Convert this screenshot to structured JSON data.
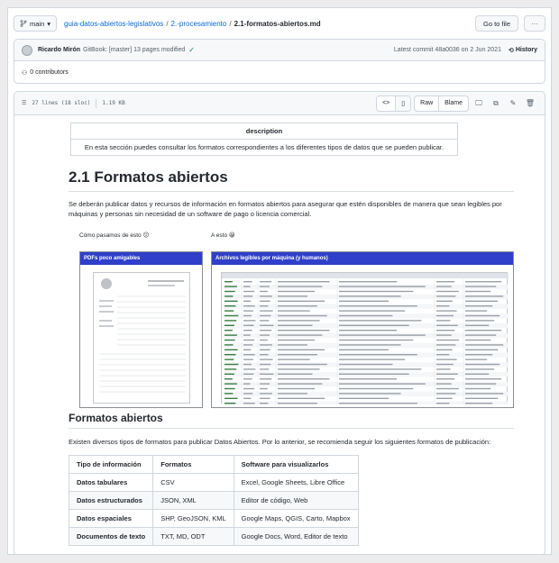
{
  "topbar": {
    "branch": "main",
    "crumbs": [
      {
        "text": "guia-datos-abiertos-legislativos",
        "link": true
      },
      {
        "text": "2.-procesamiento",
        "link": true
      },
      {
        "text": "2.1-formatos-abiertos.md",
        "link": false
      }
    ],
    "go_to_file": "Go to file",
    "more": "···"
  },
  "commit": {
    "author": "Ricardo Mirón",
    "message": "GitBook: [master] 13 pages modified",
    "latest": "Latest commit 48a0036 on 2 Jun 2021",
    "history": "History",
    "contributors": "0 contributors"
  },
  "file": {
    "lines": "27 lines (18 sloc)",
    "size": "1.19 KB",
    "raw": "Raw",
    "blame": "Blame"
  },
  "doc": {
    "desc_header": "description",
    "desc_text": "En esta sección puedes consultar los formatos correspondientes a los diferentes tipos de datos que se pueden publicar.",
    "h1": "2.1 Formatos abiertos",
    "intro": "Se deberán publicar datos y recursos de información en formatos abiertos para asegurar que estén disponibles de manera que sean legibles por máquinas y personas sin necesidad de un software de pago o licencia comercial.",
    "fig_left_caption": "Cómo pasamos de esto 😕",
    "fig_right_caption": "A esto 😀",
    "fig_left_title": "PDFs poco amigables",
    "fig_right_title": "Archivos legibles por máquina (y humanos)",
    "h2": "Formatos abiertos",
    "formats_intro": "Existen diversos tipos de formatos para publicar Datos Abiertos. Por lo anterior, se recomienda seguir los siguientes formatos de publicación:",
    "table": {
      "headers": [
        "Tipo de información",
        "Formatos",
        "Software para visualizarlos"
      ],
      "rows": [
        [
          "Datos tabulares",
          "CSV",
          "Excel, Google Sheets, Libre Office"
        ],
        [
          "Datos estructurados",
          "JSON, XML",
          "Editor de código, Web"
        ],
        [
          "Datos espaciales",
          "SHP, GeoJSON, KML",
          "Google Maps, QGIS, Carto, Mapbox"
        ],
        [
          "Documentos de texto",
          "TXT, MD, ODT",
          "Google Docs, Word, Editor de texto"
        ]
      ]
    }
  },
  "colors": {
    "link": "#0969da",
    "band": "#2f3fc9",
    "check": "#1a7f37"
  }
}
